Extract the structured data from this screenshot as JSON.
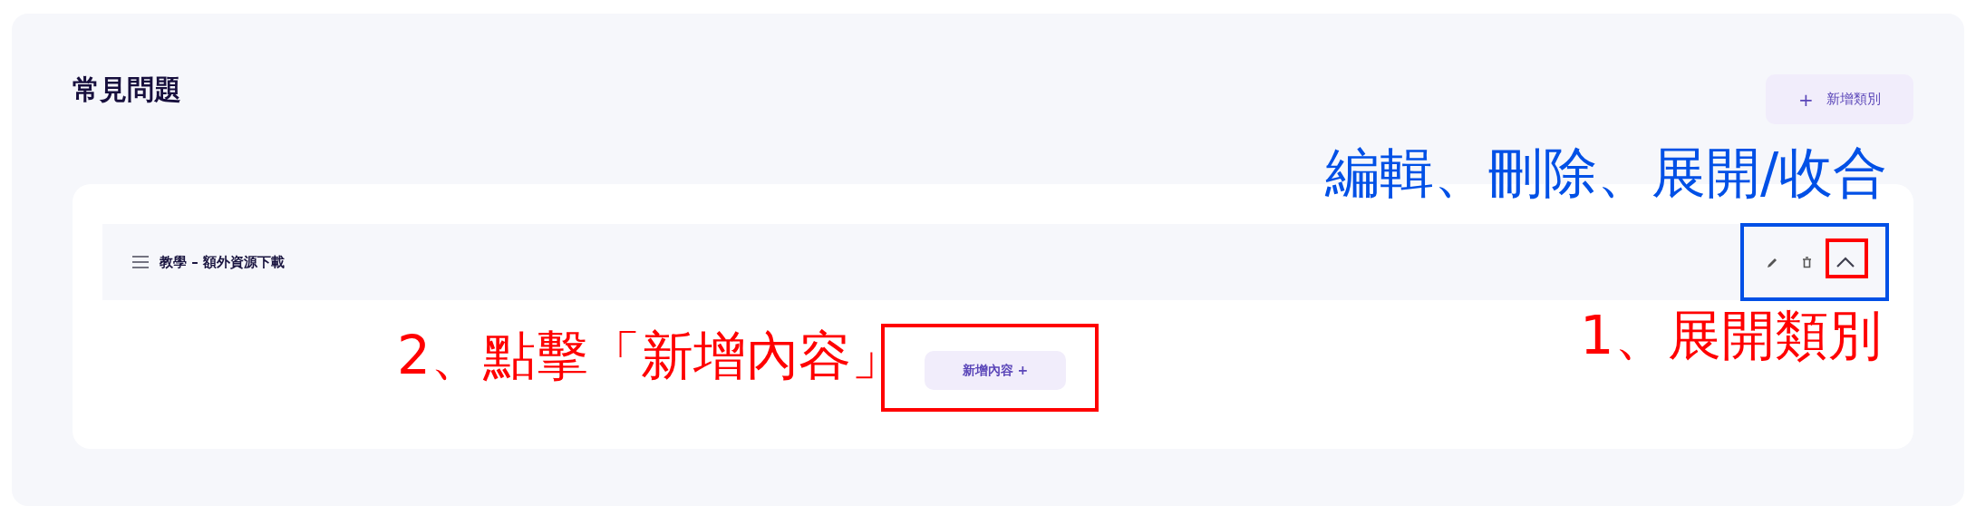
{
  "page": {
    "title": "常見問題",
    "add_category_button": {
      "icon": "+",
      "label": "新增類別"
    }
  },
  "categories": [
    {
      "name": "教學 – 額外資源下載",
      "expanded": true,
      "add_content_button": "新增內容 +"
    }
  ],
  "annotations": {
    "actions_label": {
      "text": "編輯、刪除、展開/收合",
      "color": "#0050e6"
    },
    "actions_frame": {
      "color": "#0050e6"
    },
    "expand_frame": {
      "color": "#ff0000"
    },
    "expand_label": {
      "text": "1、展開類別",
      "color": "#ff0000"
    },
    "add_label": {
      "text": "2、點擊「新增內容」",
      "color": "#ff0000"
    },
    "add_frame": {
      "color": "#ff0000"
    }
  }
}
